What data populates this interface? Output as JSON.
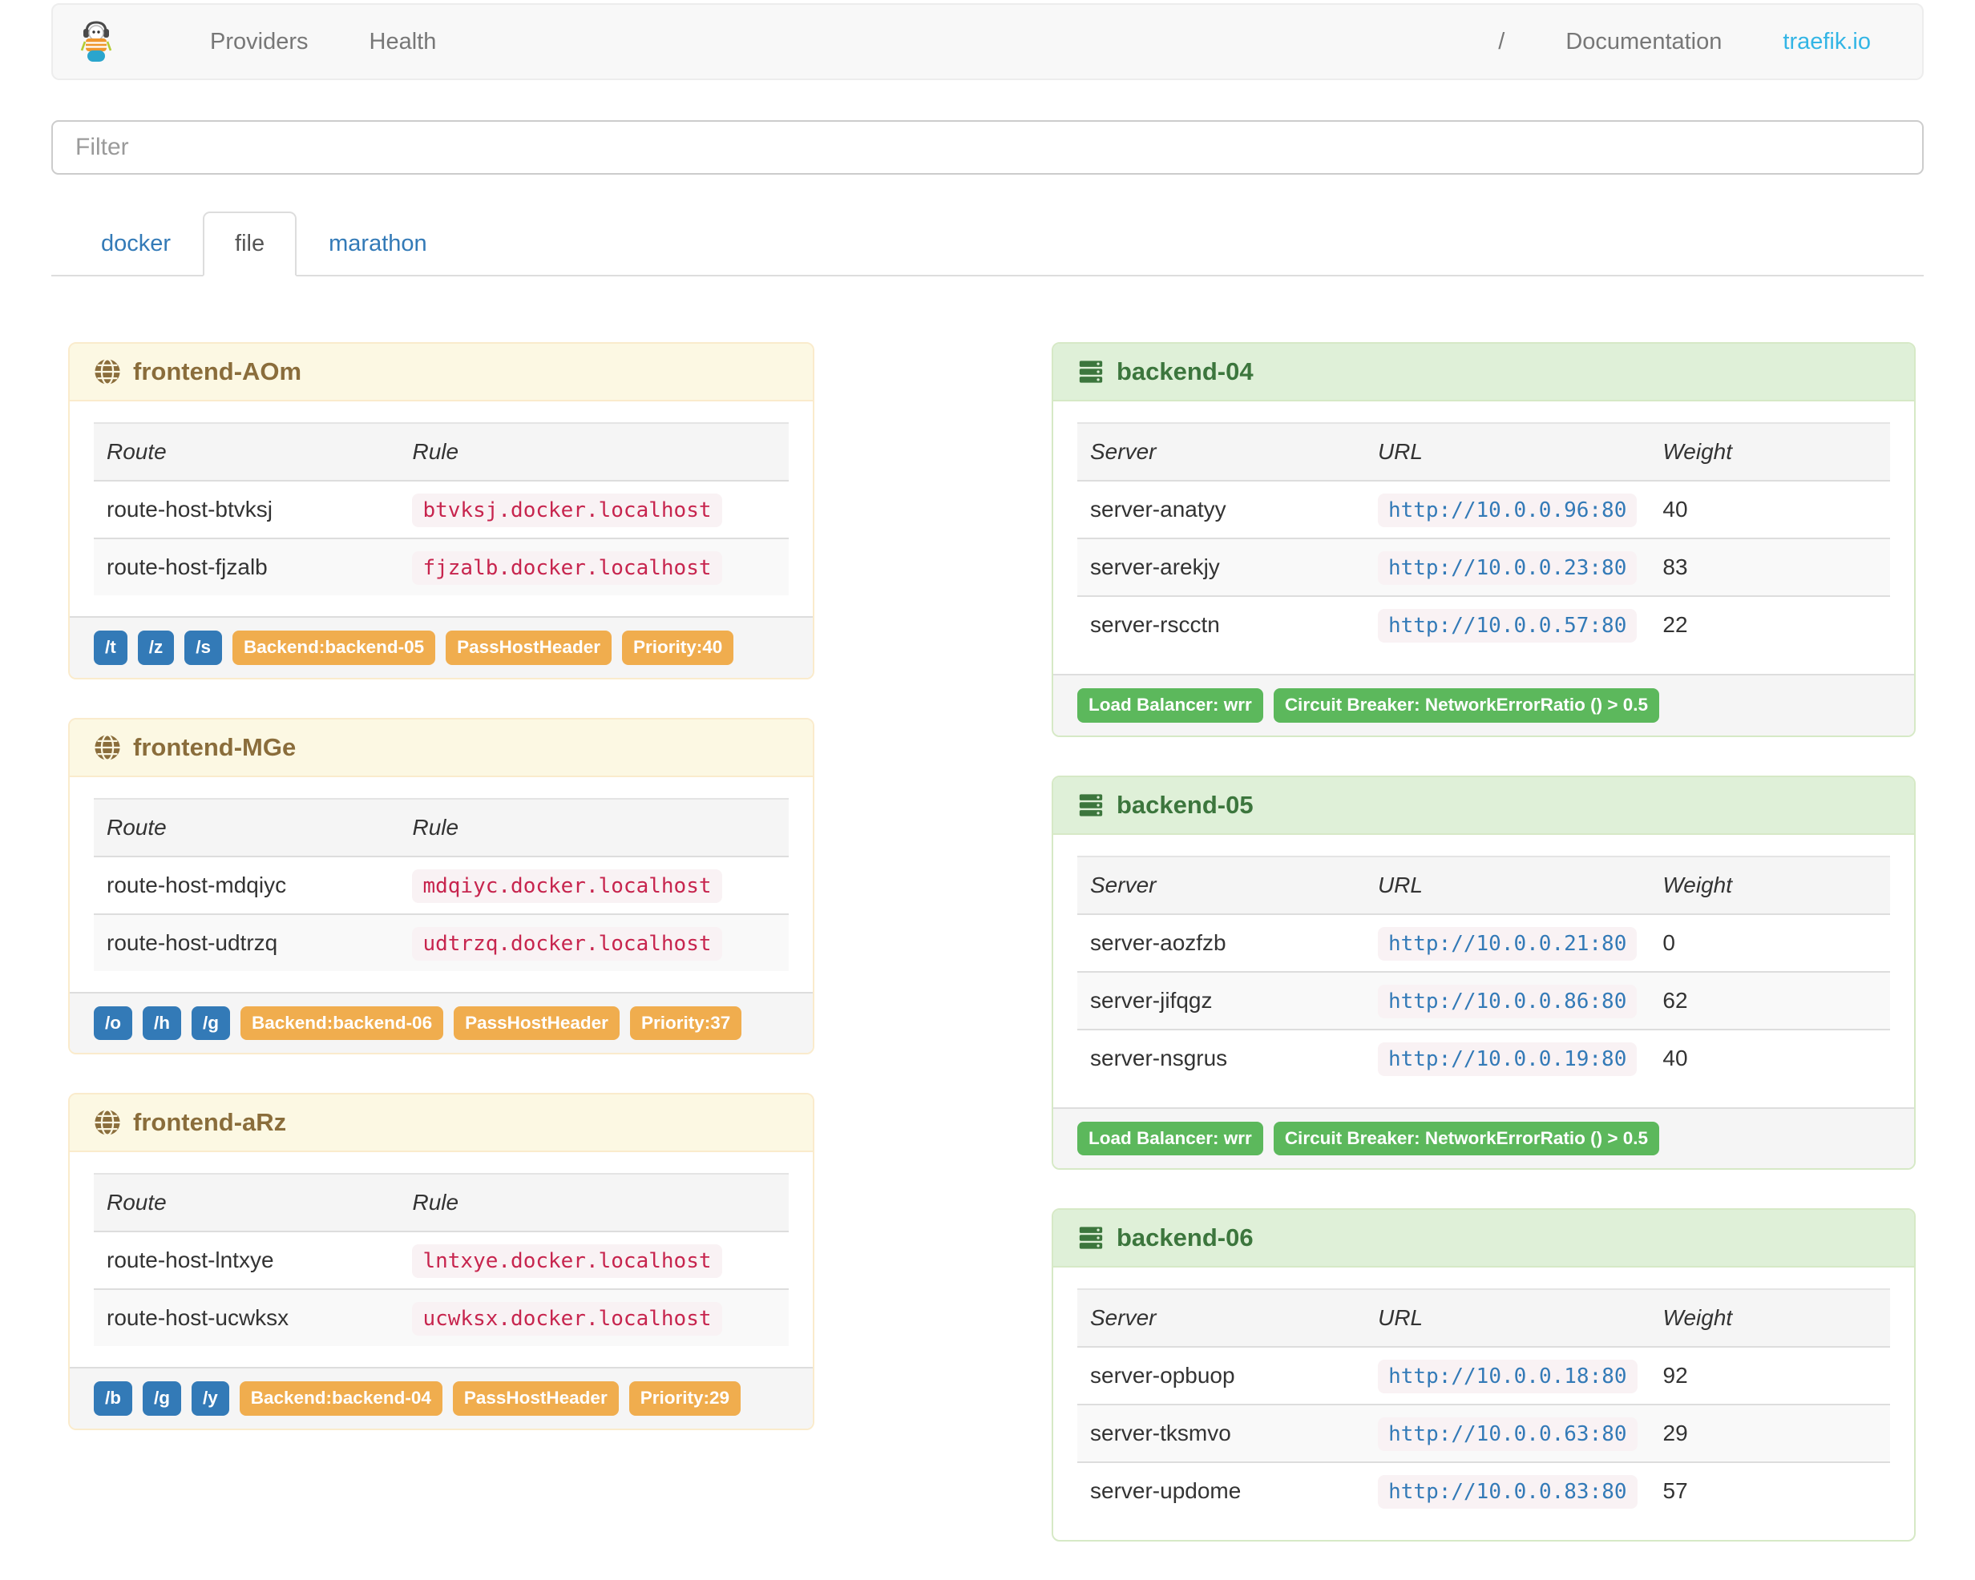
{
  "navbar": {
    "logo_icon": "traefik-mascot-logo",
    "links": [
      {
        "label": "Providers"
      },
      {
        "label": "Health"
      }
    ],
    "right_links": [
      {
        "label": "/"
      },
      {
        "label": "Documentation"
      },
      {
        "label": "traefik.io"
      }
    ]
  },
  "filter": {
    "placeholder": "Filter",
    "value": ""
  },
  "tabs": [
    {
      "label": "docker",
      "active": false
    },
    {
      "label": "file",
      "active": true
    },
    {
      "label": "marathon",
      "active": false
    }
  ],
  "frontend_columns": [
    "Route",
    "Rule"
  ],
  "backend_columns": [
    "Server",
    "URL",
    "Weight"
  ],
  "frontends": [
    {
      "name": "frontend-AOm",
      "icon": "globe-icon",
      "routes": [
        {
          "route": "route-host-btvksj",
          "rule": "btvksj.docker.localhost"
        },
        {
          "route": "route-host-fjzalb",
          "rule": "fjzalb.docker.localhost"
        }
      ],
      "path_labels": [
        "/t",
        "/z",
        "/s"
      ],
      "config_labels": [
        "Backend:backend-05",
        "PassHostHeader",
        "Priority:40"
      ]
    },
    {
      "name": "frontend-MGe",
      "icon": "globe-icon",
      "routes": [
        {
          "route": "route-host-mdqiyc",
          "rule": "mdqiyc.docker.localhost"
        },
        {
          "route": "route-host-udtrzq",
          "rule": "udtrzq.docker.localhost"
        }
      ],
      "path_labels": [
        "/o",
        "/h",
        "/g"
      ],
      "config_labels": [
        "Backend:backend-06",
        "PassHostHeader",
        "Priority:37"
      ]
    },
    {
      "name": "frontend-aRz",
      "icon": "globe-icon",
      "routes": [
        {
          "route": "route-host-lntxye",
          "rule": "lntxye.docker.localhost"
        },
        {
          "route": "route-host-ucwksx",
          "rule": "ucwksx.docker.localhost"
        }
      ],
      "path_labels": [
        "/b",
        "/g",
        "/y"
      ],
      "config_labels": [
        "Backend:backend-04",
        "PassHostHeader",
        "Priority:29"
      ]
    }
  ],
  "backends": [
    {
      "name": "backend-04",
      "icon": "server-icon",
      "servers": [
        {
          "server": "server-anatyy",
          "url": "http://10.0.0.96:80",
          "weight": "40"
        },
        {
          "server": "server-arekjy",
          "url": "http://10.0.0.23:80",
          "weight": "83"
        },
        {
          "server": "server-rscctn",
          "url": "http://10.0.0.57:80",
          "weight": "22"
        }
      ],
      "footer_labels": [
        "Load Balancer: wrr",
        "Circuit Breaker: NetworkErrorRatio () > 0.5"
      ]
    },
    {
      "name": "backend-05",
      "icon": "server-icon",
      "servers": [
        {
          "server": "server-aozfzb",
          "url": "http://10.0.0.21:80",
          "weight": "0"
        },
        {
          "server": "server-jifqgz",
          "url": "http://10.0.0.86:80",
          "weight": "62"
        },
        {
          "server": "server-nsgrus",
          "url": "http://10.0.0.19:80",
          "weight": "40"
        }
      ],
      "footer_labels": [
        "Load Balancer: wrr",
        "Circuit Breaker: NetworkErrorRatio () > 0.5"
      ]
    },
    {
      "name": "backend-06",
      "icon": "server-icon",
      "servers": [
        {
          "server": "server-opbuop",
          "url": "http://10.0.0.18:80",
          "weight": "92"
        },
        {
          "server": "server-tksmvo",
          "url": "http://10.0.0.63:80",
          "weight": "29"
        },
        {
          "server": "server-updome",
          "url": "http://10.0.0.83:80",
          "weight": "57"
        }
      ],
      "footer_labels": []
    }
  ],
  "colors": {
    "primary_label": "#337ab7",
    "warning_label": "#f0ad4e",
    "success_label": "#5cb85c",
    "frontend_header_bg": "#fcf8e3",
    "frontend_header_text": "#8a6d3b",
    "backend_header_bg": "#dff0d8",
    "backend_header_text": "#3c763d",
    "code_bg": "#f9f2f4",
    "rule_code_text": "#c7254e",
    "url_code_text": "#337ab7",
    "traefik_link": "#33b5e5"
  }
}
